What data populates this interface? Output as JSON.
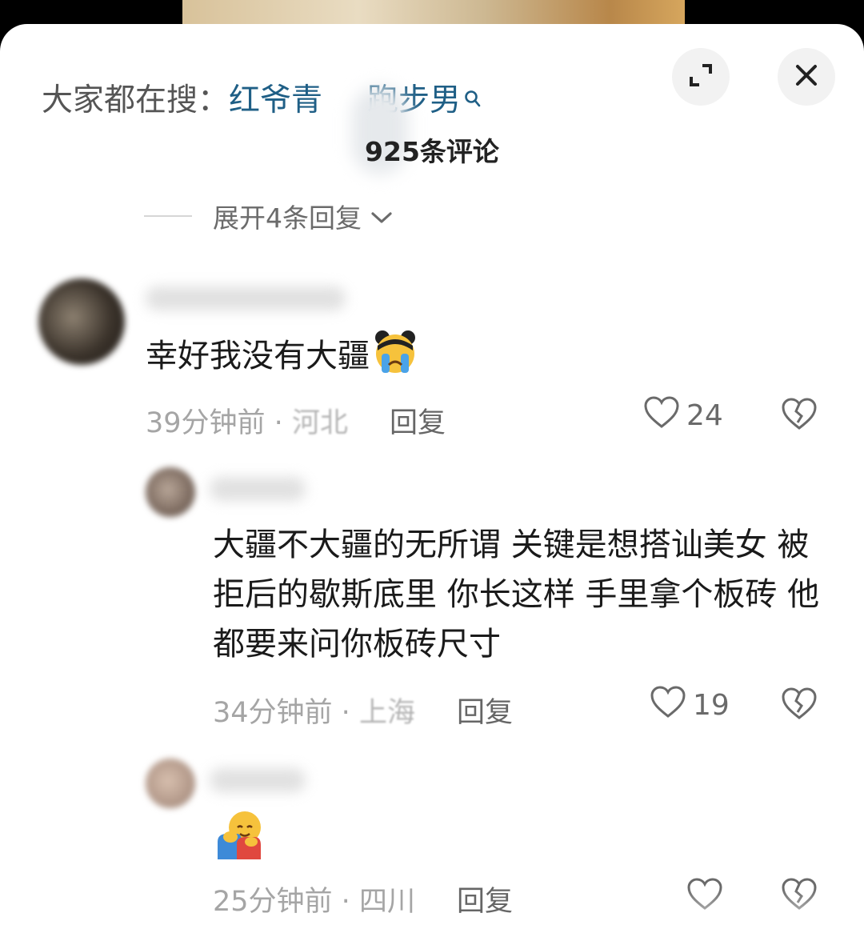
{
  "search": {
    "prefix": "大家都在搜：",
    "term_part1": "红爷青",
    "term_part2": "跑步男"
  },
  "header": {
    "comment_count": "925条评论",
    "expand_replies": "展开4条回复"
  },
  "comments": [
    {
      "text": "幸好我没有大疆",
      "time": "39分钟前",
      "location": "河北",
      "reply_label": "回复",
      "likes": "24"
    },
    {
      "text": "大疆不大疆的无所谓 关键是想搭讪美女 被拒后的歇斯底里 你长这样 手里拿个板砖 他都要来问你板砖尺寸",
      "time": "34分钟前",
      "location": "上海",
      "reply_label": "回复",
      "likes": "19"
    },
    {
      "text": "",
      "time": "25分钟前",
      "location": "四川",
      "reply_label": "回复",
      "likes": ""
    }
  ],
  "separator": " · ",
  "icons": {
    "search": "search-icon",
    "expand": "expand-icon",
    "close": "close-icon",
    "like": "heart-icon",
    "dislike": "broken-heart-icon",
    "chevron": "chevron-down-icon"
  },
  "colors": {
    "search_term": "#1f5f86",
    "meta_text": "#a5a5a5",
    "sheet_bg": "#ffffff"
  }
}
